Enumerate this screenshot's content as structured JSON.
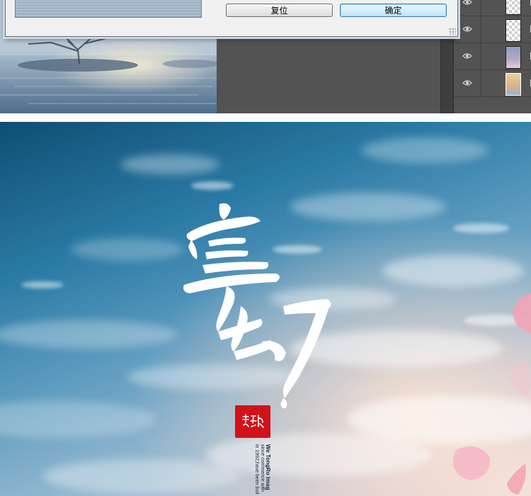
{
  "dialog": {
    "reset_label": "复位",
    "ok_label": "确定"
  },
  "poster": {
    "title_chars": [
      "宣",
      "幻"
    ],
    "subtitle_lines": [
      "We TongRo Imag",
      "since commence with",
      "in 1992,have been buil"
    ]
  },
  "colors": {
    "seal_red": "#d1121b",
    "ok_border": "#3c7fb1",
    "ps_gray": "#535353"
  }
}
